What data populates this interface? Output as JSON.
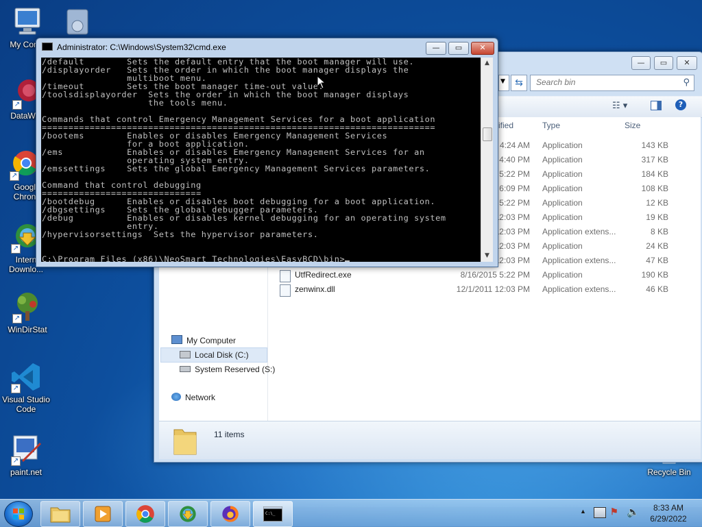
{
  "desktop": {
    "icons": [
      {
        "label": "My Comp",
        "icon": "my-computer-icon"
      },
      {
        "label": "DataWag",
        "icon": "datawag-icon"
      },
      {
        "label": "Google Chron",
        "line1": "Googl",
        "line2": "Chron",
        "icon": "chrome-icon"
      },
      {
        "label": "Internet Download",
        "line1": "Intern",
        "line2": "Downlo...",
        "icon": "idm-icon"
      },
      {
        "label": "WinDirStat",
        "icon": "windirstat-icon"
      },
      {
        "label": "Visual Studio Code",
        "line1": "Visual Studio",
        "line2": "Code",
        "icon": "vscode-icon"
      },
      {
        "label": "paint.net",
        "icon": "paintnet-icon"
      },
      {
        "label": "Recycle Bin",
        "icon": "recycle-bin-icon"
      }
    ]
  },
  "cmd": {
    "title": "Administrator: C:\\Windows\\System32\\cmd.exe",
    "lines": [
      "/default        Sets the default entry that the boot manager will use.",
      "/displayorder   Sets the order in which the boot manager displays the",
      "                multiboot menu.",
      "/timeout        Sets the boot manager time-out value.",
      "/toolsdisplayorder  Sets the order in which the boot manager displays",
      "                    the tools menu.",
      "",
      "Commands that control Emergency Management Services for a boot application",
      "==========================================================================",
      "/bootems        Enables or disables Emergency Management Services",
      "                for a boot application.",
      "/ems            Enables or disables Emergency Management Services for an",
      "                operating system entry.",
      "/emssettings    Sets the global Emergency Management Services parameters.",
      "",
      "Command that control debugging",
      "==============================",
      "/bootdebug      Enables or disables boot debugging for a boot application.",
      "/dbgsettings    Sets the global debugger parameters.",
      "/debug          Enables or disables kernel debugging for an operating system",
      "                entry.",
      "/hypervisorsettings  Sets the hypervisor parameters.",
      "",
      ""
    ],
    "prompt": "C:\\Program Files (x86)\\NeoSmart Technologies\\EasyBCD\\bin>"
  },
  "explorer": {
    "search_placeholder": "Search bin",
    "columns": {
      "date": "ified",
      "type": "Type",
      "size": "Size"
    },
    "nav": {
      "my_computer": "My Computer",
      "local_disk": "Local Disk (C:)",
      "system_reserved": "System Reserved (S:)",
      "network": "Network"
    },
    "rows": [
      {
        "name": "",
        "date": "4:24 AM",
        "type": "Application",
        "size": "143 KB"
      },
      {
        "name": "",
        "date": "4:40 PM",
        "type": "Application",
        "size": "317 KB"
      },
      {
        "name": "",
        "date": "5:22 PM",
        "type": "Application",
        "size": "184 KB"
      },
      {
        "name": "",
        "date": "6:09 PM",
        "type": "Application",
        "size": "108 KB"
      },
      {
        "name": "",
        "date": "5:22 PM",
        "type": "Application",
        "size": "12 KB"
      },
      {
        "name": "",
        "date": "12:03 PM",
        "type": "Application",
        "size": "19 KB"
      },
      {
        "name": "",
        "date": "12:03 PM",
        "type": "Application extens...",
        "size": "8 KB"
      },
      {
        "name": "",
        "date": "12:03 PM",
        "type": "Application",
        "size": "24 KB"
      },
      {
        "name": "",
        "date": "12:03 PM",
        "type": "Application extens...",
        "size": "47 KB"
      },
      {
        "name": "UtfRedirect.exe",
        "date": "8/16/2015 5:22 PM",
        "type": "Application",
        "size": "190 KB"
      },
      {
        "name": "zenwinx.dll",
        "date": "12/1/2011 12:03 PM",
        "type": "Application extens...",
        "size": "46 KB"
      }
    ],
    "item_count": "11 items"
  },
  "taskbar": {
    "time": "8:33 AM",
    "date": "6/29/2022",
    "buttons": [
      "explorer-icon",
      "media-player-icon",
      "chrome-icon",
      "idm-icon",
      "firefox-icon",
      "cmd-icon"
    ]
  }
}
